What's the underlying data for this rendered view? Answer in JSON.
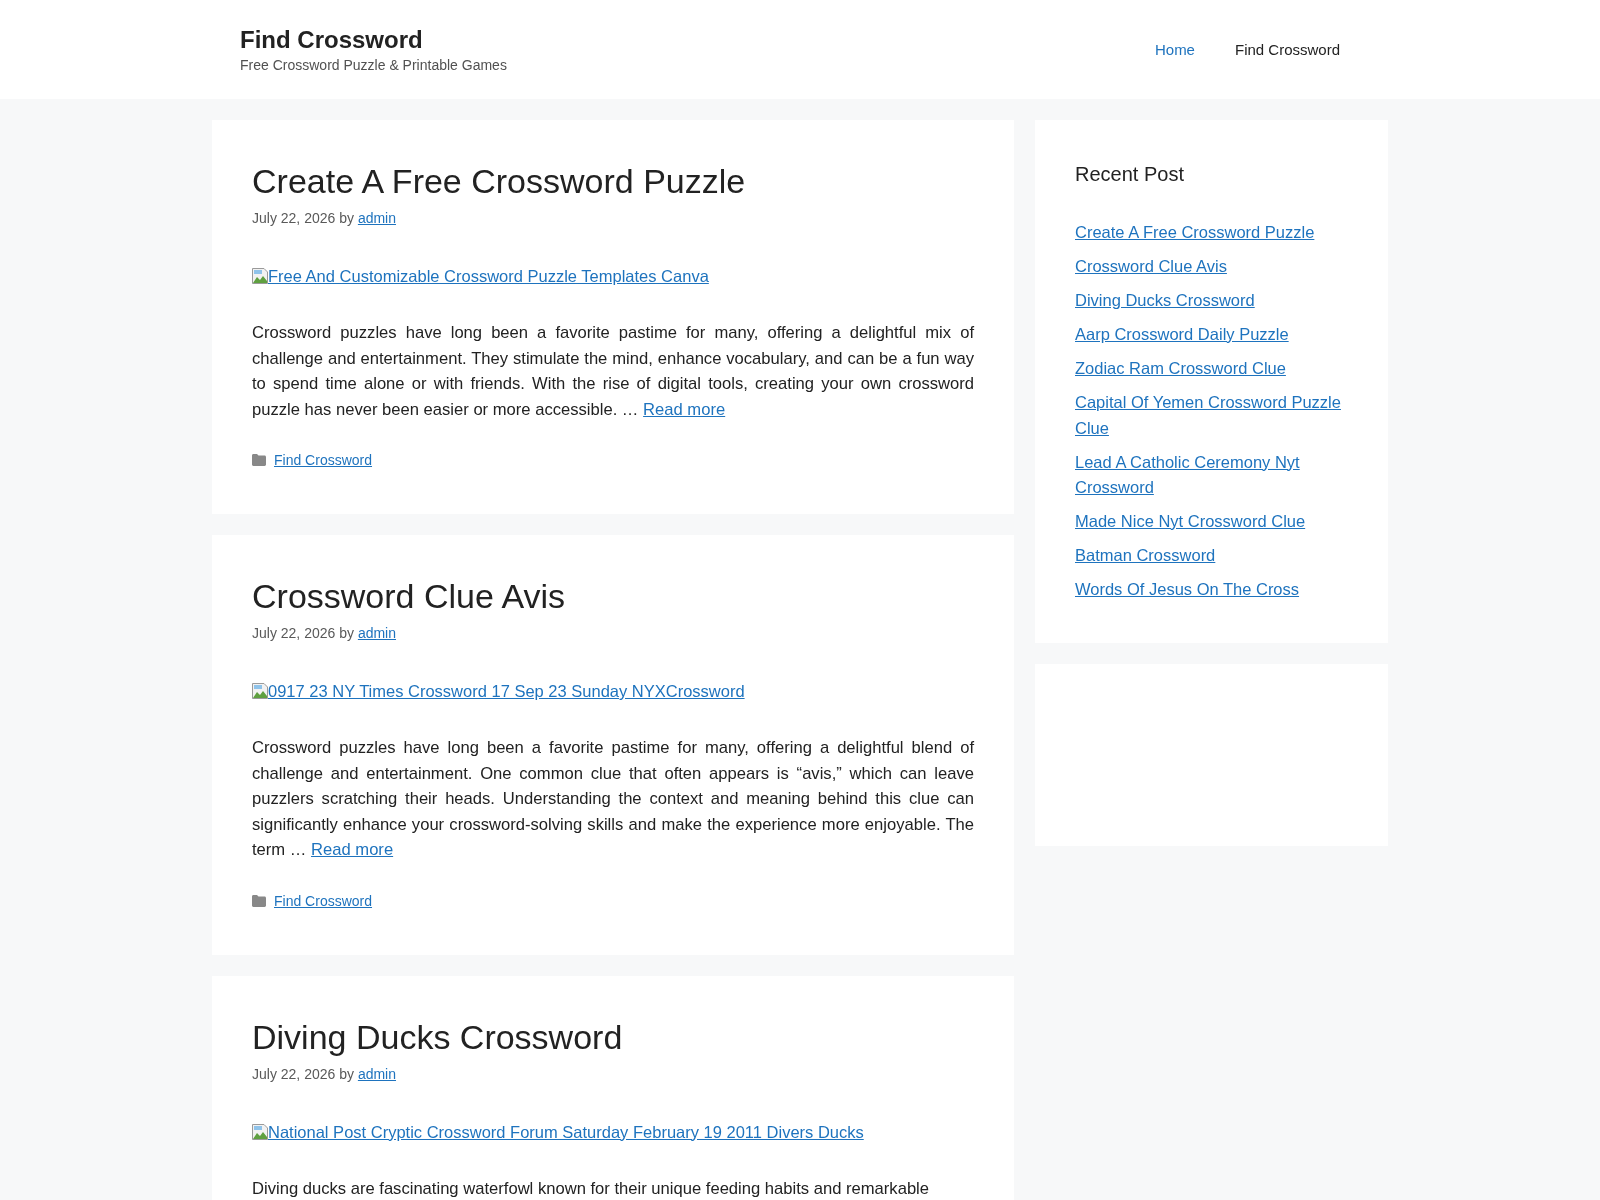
{
  "header": {
    "site_title": "Find Crossword",
    "tagline": "Free Crossword Puzzle & Printable Games",
    "nav": [
      {
        "label": "Home",
        "selected": true
      },
      {
        "label": "Find Crossword",
        "selected": false
      }
    ]
  },
  "posts": [
    {
      "title": "Create A Free Crossword Puzzle",
      "date": "July 22, 2026",
      "by": "by",
      "author": "admin",
      "image_alt": "Free And Customizable Crossword Puzzle Templates Canva",
      "excerpt": "Crossword puzzles have long been a favorite pastime for many, offering a delightful mix of challenge and entertainment. They stimulate the mind, enhance vocabulary, and can be a fun way to spend time alone or with friends. With the rise of digital tools, creating your own crossword puzzle has never been easier or more accessible. …",
      "read_more": "Read more",
      "category": "Find Crossword"
    },
    {
      "title": "Crossword Clue Avis",
      "date": "July 22, 2026",
      "by": "by",
      "author": "admin",
      "image_alt": "0917 23 NY Times Crossword 17 Sep 23 Sunday NYXCrossword",
      "excerpt": "Crossword puzzles have long been a favorite pastime for many, offering a delightful blend of challenge and entertainment. One common clue that often appears is “avis,” which can leave puzzlers scratching their heads. Understanding the context and meaning behind this clue can significantly enhance your crossword-solving skills and make the experience more enjoyable. The term …",
      "read_more": "Read more",
      "category": "Find Crossword"
    },
    {
      "title": "Diving Ducks Crossword",
      "date": "July 22, 2026",
      "by": "by",
      "author": "admin",
      "image_alt": "National Post Cryptic Crossword Forum Saturday February 19 2011 Divers Ducks",
      "excerpt": "Diving ducks are fascinating waterfowl known for their unique feeding habits and remarkable"
    }
  ],
  "sidebar": {
    "title": "Recent Post",
    "links": [
      "Create A Free Crossword Puzzle",
      "Crossword Clue Avis",
      "Diving Ducks Crossword",
      "Aarp Crossword Daily Puzzle",
      "Zodiac Ram Crossword Clue",
      "Capital Of Yemen Crossword Puzzle Clue",
      "Lead A Catholic Ceremony Nyt Crossword",
      "Made Nice Nyt Crossword Clue",
      "Batman Crossword",
      "Words Of Jesus On The Cross"
    ]
  }
}
